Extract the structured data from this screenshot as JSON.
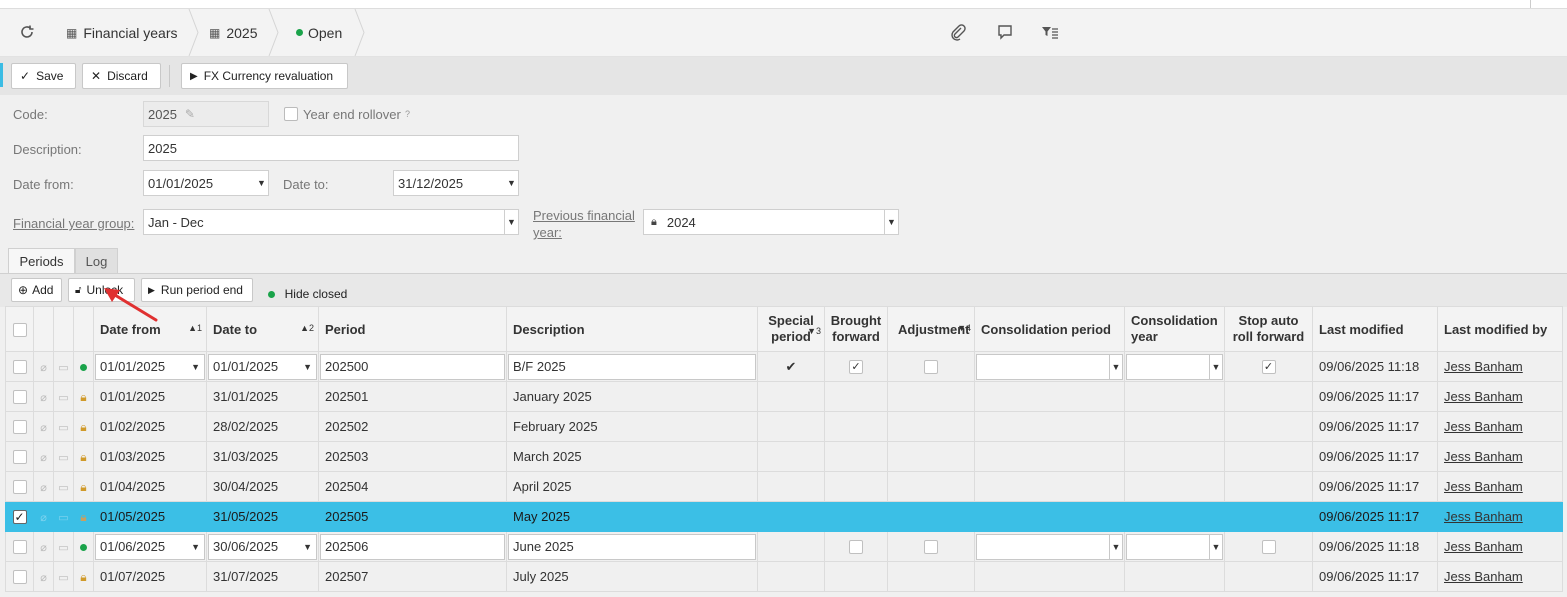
{
  "breadcrumb": {
    "item1": "Financial years",
    "item2": "2025",
    "item3": "Open"
  },
  "toolbar": {
    "save": "Save",
    "discard": "Discard",
    "fx": "FX Currency revaluation"
  },
  "form": {
    "code_label": "Code:",
    "code_value": "2025",
    "year_end_rollover": "Year end rollover",
    "help": "?",
    "description_label": "Description:",
    "description_value": "2025",
    "date_from_label": "Date from:",
    "date_from_value": "01/01/2025",
    "date_to_label": "Date to:",
    "date_to_value": "31/12/2025",
    "fy_group_label": "Financial year group:",
    "fy_group_value": "Jan - Dec",
    "prev_fy_label_1": "Previous financial",
    "prev_fy_label_2": "year:",
    "prev_fy_value": "2024"
  },
  "tabs": {
    "periods": "Periods",
    "log": "Log"
  },
  "grid_toolbar": {
    "add": "Add",
    "unlock": "Unlock",
    "run_period_end": "Run period end",
    "hide_closed": "Hide closed"
  },
  "columns": {
    "date_from": "Date from",
    "date_from_sort": "▲1",
    "date_to": "Date to",
    "date_to_sort": "▲2",
    "period": "Period",
    "description": "Description",
    "special_1": "Special",
    "special_2": "period",
    "special_sort": "▼3",
    "brought_1": "Brought",
    "brought_2": "forward",
    "adjustment": "Adjustment",
    "adjustment_sort": "▼4",
    "consolidation_period": "Consolidation period",
    "consolidation_year_1": "Consolidation",
    "consolidation_year_2": "year",
    "stop_1": "Stop auto",
    "stop_2": "roll forward",
    "last_modified": "Last modified",
    "last_modified_by": "Last modified by"
  },
  "rows": [
    {
      "date_from": "01/01/2025",
      "date_to": "01/01/2025",
      "period": "202500",
      "description": "B/F 2025",
      "modified": "09/06/2025 11:18",
      "by": "Jess Banham"
    },
    {
      "date_from": "01/01/2025",
      "date_to": "31/01/2025",
      "period": "202501",
      "description": "January 2025",
      "modified": "09/06/2025 11:17",
      "by": "Jess Banham"
    },
    {
      "date_from": "01/02/2025",
      "date_to": "28/02/2025",
      "period": "202502",
      "description": "February 2025",
      "modified": "09/06/2025 11:17",
      "by": "Jess Banham"
    },
    {
      "date_from": "01/03/2025",
      "date_to": "31/03/2025",
      "period": "202503",
      "description": "March 2025",
      "modified": "09/06/2025 11:17",
      "by": "Jess Banham"
    },
    {
      "date_from": "01/04/2025",
      "date_to": "30/04/2025",
      "period": "202504",
      "description": "April 2025",
      "modified": "09/06/2025 11:17",
      "by": "Jess Banham"
    },
    {
      "date_from": "01/05/2025",
      "date_to": "31/05/2025",
      "period": "202505",
      "description": "May 2025",
      "modified": "09/06/2025 11:17",
      "by": "Jess Banham"
    },
    {
      "date_from": "01/06/2025",
      "date_to": "30/06/2025",
      "period": "202506",
      "description": "June 2025",
      "modified": "09/06/2025 11:18",
      "by": "Jess Banham"
    },
    {
      "date_from": "01/07/2025",
      "date_to": "31/07/2025",
      "period": "202507",
      "description": "July 2025",
      "modified": "09/06/2025 11:17",
      "by": "Jess Banham"
    }
  ],
  "colors": {
    "selected_row": "#3bbfe6",
    "open_dot": "#1aa34a",
    "lock": "#d09a2a",
    "annotation_arrow": "#e03030"
  }
}
